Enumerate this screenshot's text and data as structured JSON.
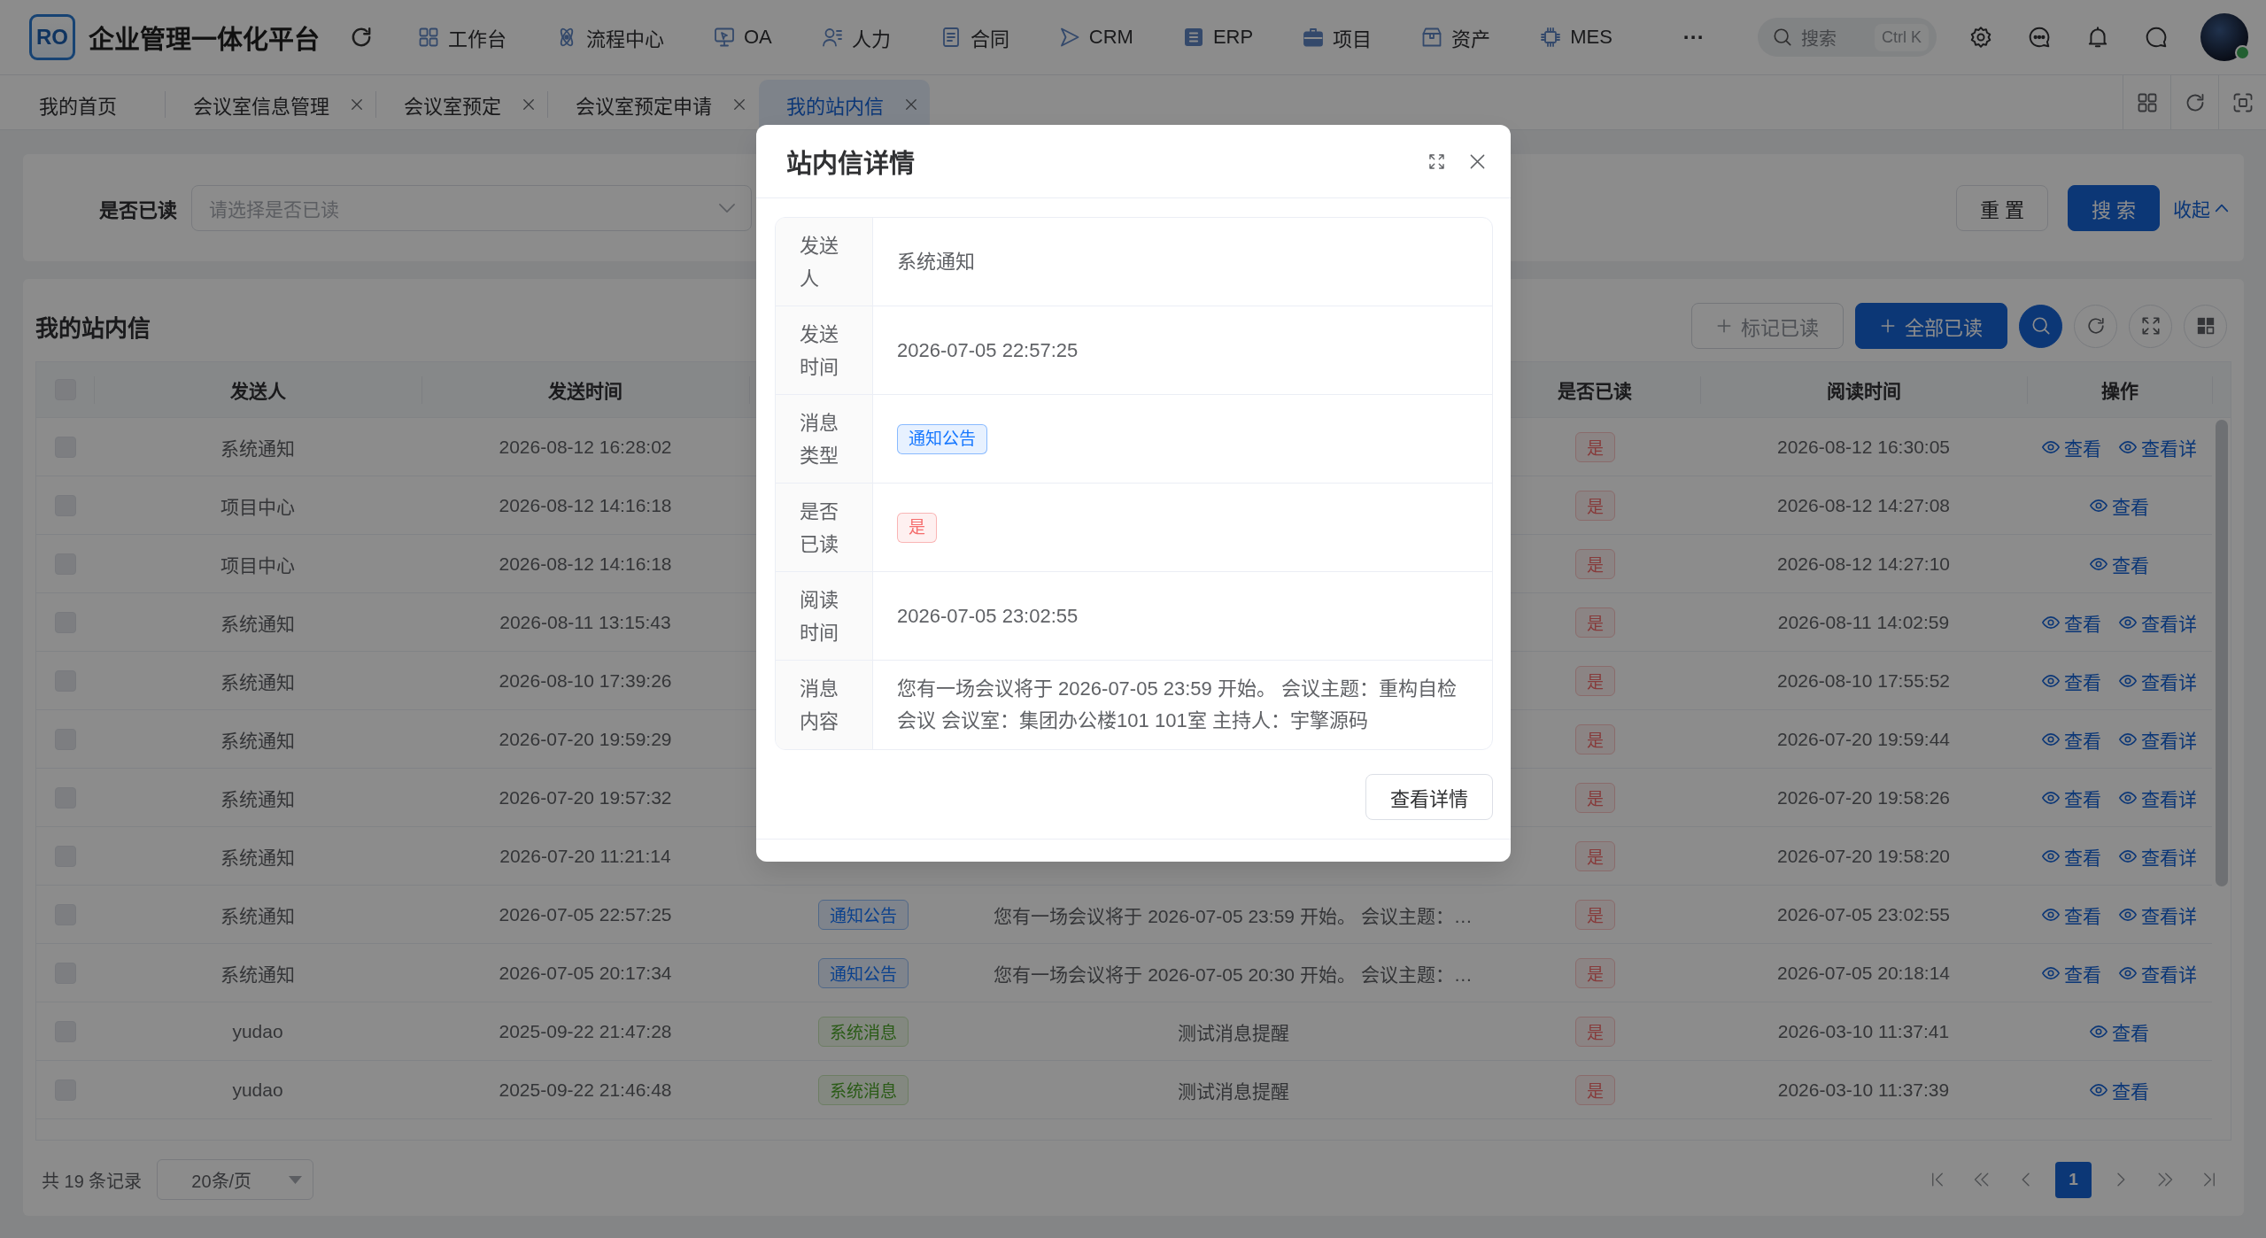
{
  "header": {
    "logo_text": "RO",
    "title": "企业管理一体化平台",
    "menu": [
      {
        "label": "工作台"
      },
      {
        "label": "流程中心"
      },
      {
        "label": "OA"
      },
      {
        "label": "人力"
      },
      {
        "label": "合同"
      },
      {
        "label": "CRM"
      },
      {
        "label": "ERP"
      },
      {
        "label": "项目"
      },
      {
        "label": "资产"
      },
      {
        "label": "MES"
      }
    ],
    "more": "···",
    "search": {
      "placeholder": "搜索",
      "shortcut": "Ctrl K"
    },
    "avatar": {
      "online": true
    }
  },
  "tabs": [
    {
      "label": "我的首页",
      "closable": false,
      "selected": false
    },
    {
      "label": "会议室信息管理",
      "closable": true,
      "selected": false
    },
    {
      "label": "会议室预定",
      "closable": true,
      "selected": false
    },
    {
      "label": "会议室预定申请",
      "closable": true,
      "selected": false
    },
    {
      "label": "我的站内信",
      "closable": true,
      "selected": true
    }
  ],
  "filter": {
    "label": "是否已读",
    "placeholder": "请选择是否已读",
    "reset": "重 置",
    "search": "搜 索",
    "collapse": "收起"
  },
  "list": {
    "title": "我的站内信",
    "actions": [
      {
        "label": "标记已读",
        "disabled": true
      },
      {
        "label": "全部已读",
        "disabled": false
      }
    ],
    "tool_buttons": [
      {
        "on": true
      },
      {
        "on": false
      },
      {
        "on": false
      },
      {
        "on": false
      }
    ],
    "table": {
      "select_all": {
        "checked": false,
        "disabled": true
      },
      "columns": {
        "sender": "发送人",
        "sent_time": "发送时间",
        "read": "是否已读",
        "read_time": "阅读时间",
        "actions": "操作"
      },
      "rows": [
        {
          "checkbox": {
            "checked": false,
            "disabled": true
          },
          "sender": "系统通知",
          "sent_time": "2026-08-12 16:28:02",
          "read": "是",
          "read_time": "2026-08-12 16:30:05",
          "actions": [
            "查看",
            "查看详"
          ]
        },
        {
          "checkbox": {
            "checked": false,
            "disabled": true
          },
          "sender": "项目中心",
          "sent_time": "2026-08-12 14:16:18",
          "read": "是",
          "read_time": "2026-08-12 14:27:08",
          "actions": [
            "查看"
          ]
        },
        {
          "checkbox": {
            "checked": false,
            "disabled": true
          },
          "sender": "项目中心",
          "sent_time": "2026-08-12 14:16:18",
          "read": "是",
          "read_time": "2026-08-12 14:27:10",
          "actions": [
            "查看"
          ]
        },
        {
          "checkbox": {
            "checked": false,
            "disabled": true
          },
          "sender": "系统通知",
          "sent_time": "2026-08-11 13:15:43",
          "read": "是",
          "read_time": "2026-08-11 14:02:59",
          "actions": [
            "查看",
            "查看详"
          ]
        },
        {
          "checkbox": {
            "checked": false,
            "disabled": true
          },
          "sender": "系统通知",
          "sent_time": "2026-08-10 17:39:26",
          "read": "是",
          "read_time": "2026-08-10 17:55:52",
          "actions": [
            "查看",
            "查看详"
          ]
        },
        {
          "checkbox": {
            "checked": false,
            "disabled": true
          },
          "sender": "系统通知",
          "sent_time": "2026-07-20 19:59:29",
          "read": "是",
          "read_time": "2026-07-20 19:59:44",
          "actions": [
            "查看",
            "查看详"
          ]
        },
        {
          "checkbox": {
            "checked": false,
            "disabled": true
          },
          "sender": "系统通知",
          "sent_time": "2026-07-20 19:57:32",
          "read": "是",
          "read_time": "2026-07-20 19:58:26",
          "actions": [
            "查看",
            "查看详"
          ]
        },
        {
          "checkbox": {
            "checked": false,
            "disabled": true
          },
          "sender": "系统通知",
          "sent_time": "2026-07-20 11:21:14",
          "read": "是",
          "read_time": "2026-07-20 19:58:20",
          "actions": [
            "查看",
            "查看详"
          ]
        },
        {
          "checkbox": {
            "checked": false,
            "disabled": true
          },
          "sender": "系统通知",
          "sent_time": "2026-07-05 22:57:25",
          "type": {
            "kind": "notice",
            "label": "通知公告"
          },
          "content": "您有一场会议将于 2026-07-05 23:59 开始。 会议主题：…",
          "read": "是",
          "read_time": "2026-07-05 23:02:55",
          "actions": [
            "查看",
            "查看详"
          ]
        },
        {
          "checkbox": {
            "checked": false,
            "disabled": true
          },
          "sender": "系统通知",
          "sent_time": "2026-07-05 20:17:34",
          "type": {
            "kind": "notice",
            "label": "通知公告"
          },
          "content": "您有一场会议将于 2026-07-05 20:30 开始。 会议主题：…",
          "read": "是",
          "read_time": "2026-07-05 20:18:14",
          "actions": [
            "查看",
            "查看详"
          ]
        },
        {
          "checkbox": {
            "checked": false,
            "disabled": true
          },
          "sender": "yudao",
          "sent_time": "2025-09-22 21:47:28",
          "type": {
            "kind": "system",
            "label": "系统消息"
          },
          "content": "测试消息提醒",
          "read": "是",
          "read_time": "2026-03-10 11:37:41",
          "actions": [
            "查看"
          ]
        },
        {
          "checkbox": {
            "checked": false,
            "disabled": true
          },
          "sender": "yudao",
          "sent_time": "2025-09-22 21:46:48",
          "type": {
            "kind": "system",
            "label": "系统消息"
          },
          "content": "测试消息提醒",
          "read": "是",
          "read_time": "2026-03-10 11:37:39",
          "actions": [
            "查看"
          ]
        }
      ]
    },
    "pagination": {
      "total": "共 19 条记录",
      "page_size": "20条/页",
      "pages": [
        {
          "label": "1",
          "selected": true
        }
      ]
    }
  },
  "modal": {
    "title": "站内信详情",
    "fields": [
      {
        "kind": "text",
        "label": "发送人",
        "value": "系统通知"
      },
      {
        "kind": "text",
        "label": "发送时间",
        "value": "2026-07-05 22:57:25"
      },
      {
        "kind": "tag",
        "label": "消息类型",
        "value": "通知公告",
        "color": "#1677ff"
      },
      {
        "kind": "tag",
        "label": "是否已读",
        "value": "是",
        "color": "#f56c6c"
      },
      {
        "kind": "text",
        "label": "阅读时间",
        "value": "2026-07-05 23:02:55"
      },
      {
        "kind": "text",
        "label": "消息内容",
        "value": "您有一场会议将于 2026-07-05 23:59 开始。 会议主题：重构自检会议 会议室：集团办公楼101 101室 主持人：宇擎源码"
      }
    ],
    "footer_button": "查看详情"
  }
}
